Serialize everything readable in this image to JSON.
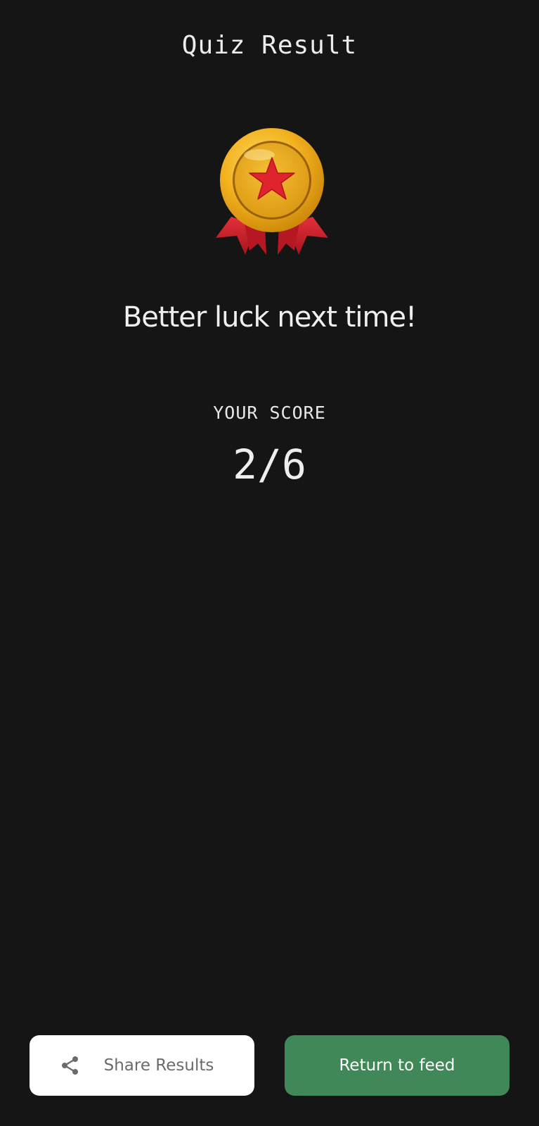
{
  "header": {
    "title": "Quiz Result"
  },
  "result": {
    "message": "Better luck next time!",
    "score_label": "YOUR SCORE",
    "score_value": "2/6",
    "medal_icon": "medal-icon"
  },
  "actions": {
    "share_label": "Share Results",
    "share_icon": "share-icon",
    "return_label": "Return to feed"
  },
  "colors": {
    "background": "#151515",
    "return_button": "#418858",
    "share_button": "#ffffff",
    "medal_gold": "#f2b01e",
    "medal_star": "#e0242e",
    "ribbon": "#c9202a"
  }
}
